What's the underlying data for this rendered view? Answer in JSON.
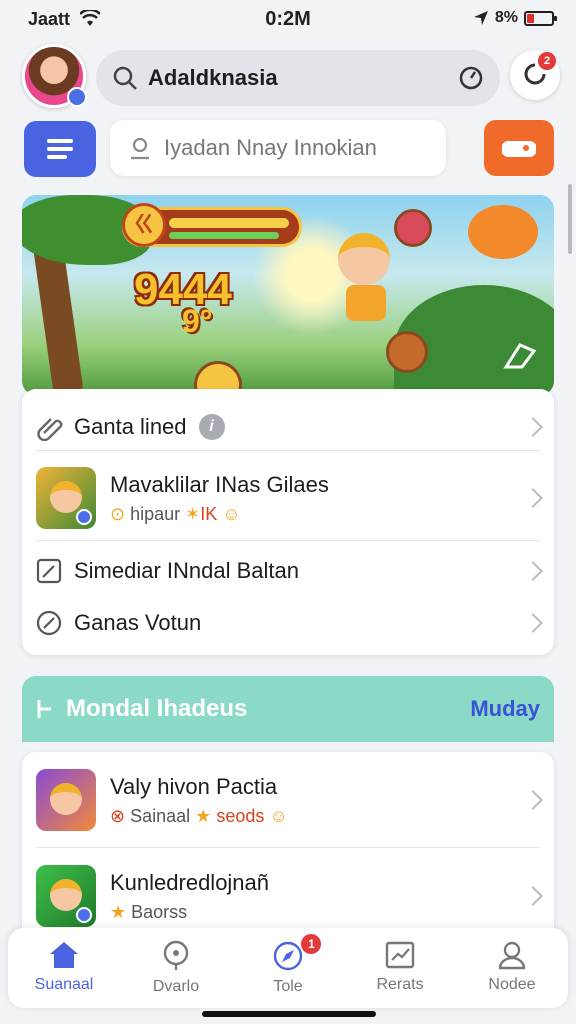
{
  "status_bar": {
    "carrier": "Jaatt",
    "time": "0:2M",
    "battery_text": "8%",
    "battery_level": 0.3
  },
  "header": {
    "search_label": "Adaldknasia",
    "notification_count": "2"
  },
  "secondary_search": {
    "placeholder": "Iyadan Nnay Innokian"
  },
  "banner": {
    "coin_text": "ㄍ",
    "score": "9444",
    "score_sub": "9°"
  },
  "list_one": {
    "item1": {
      "title": "Ganta lined",
      "info": "i"
    },
    "item2": {
      "title": "Mavaklilar INas Gilaes",
      "sub_prefix": "hipaur",
      "sub_accent": "IK"
    },
    "item3": {
      "title": "Simediar INndal Baltan"
    },
    "item4": {
      "title": "Ganas Votun"
    }
  },
  "section": {
    "title": "Mondal Ihadeus",
    "link": "Muday"
  },
  "list_two": {
    "item1": {
      "title": "Valy hivon Pactia",
      "sub_prefix": "Sainaal",
      "sub_accent": "seods"
    },
    "item2": {
      "title": "Kunledredlojnañ",
      "sub_prefix": "Baorss"
    }
  },
  "tabs": [
    {
      "label": "Suanaal",
      "icon": "home-icon",
      "active": true
    },
    {
      "label": "Dvarlo",
      "icon": "location-icon"
    },
    {
      "label": "Tole",
      "icon": "compass-icon",
      "badge": "1"
    },
    {
      "label": "Rerats",
      "icon": "chart-icon"
    },
    {
      "label": "Nodee",
      "icon": "profile-icon"
    }
  ],
  "colors": {
    "accent": "#4a63e0",
    "orange": "#f06a2a",
    "teal": "#8bd9c7",
    "badge": "#e23a3a"
  }
}
